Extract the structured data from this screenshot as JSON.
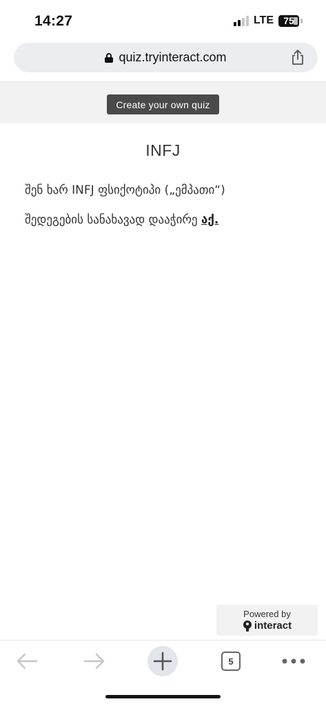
{
  "status_bar": {
    "time": "14:27",
    "network": "LTE",
    "battery": "75"
  },
  "browser": {
    "url": "quiz.tryinteract.com"
  },
  "banner": {
    "create_quiz_label": "Create your own quiz"
  },
  "result": {
    "title": "INFJ",
    "description": "შენ ხარ INFJ ფსიქოტიპი („ემპათი“)",
    "link_prefix": "შედეგების სანახავად დააჭირე ",
    "link_text": "აქ."
  },
  "powered_by": {
    "label": "Powered by",
    "brand": "interact"
  },
  "toolbar": {
    "tab_count": "5",
    "icons": [
      "back-arrow-icon",
      "forward-arrow-icon",
      "plus-icon",
      "tabs-icon",
      "more-icon"
    ]
  },
  "colors": {
    "banner_bg": "#f2f2f2",
    "button_bg": "#4a4a4a",
    "url_bar_bg": "#ebedf0"
  }
}
